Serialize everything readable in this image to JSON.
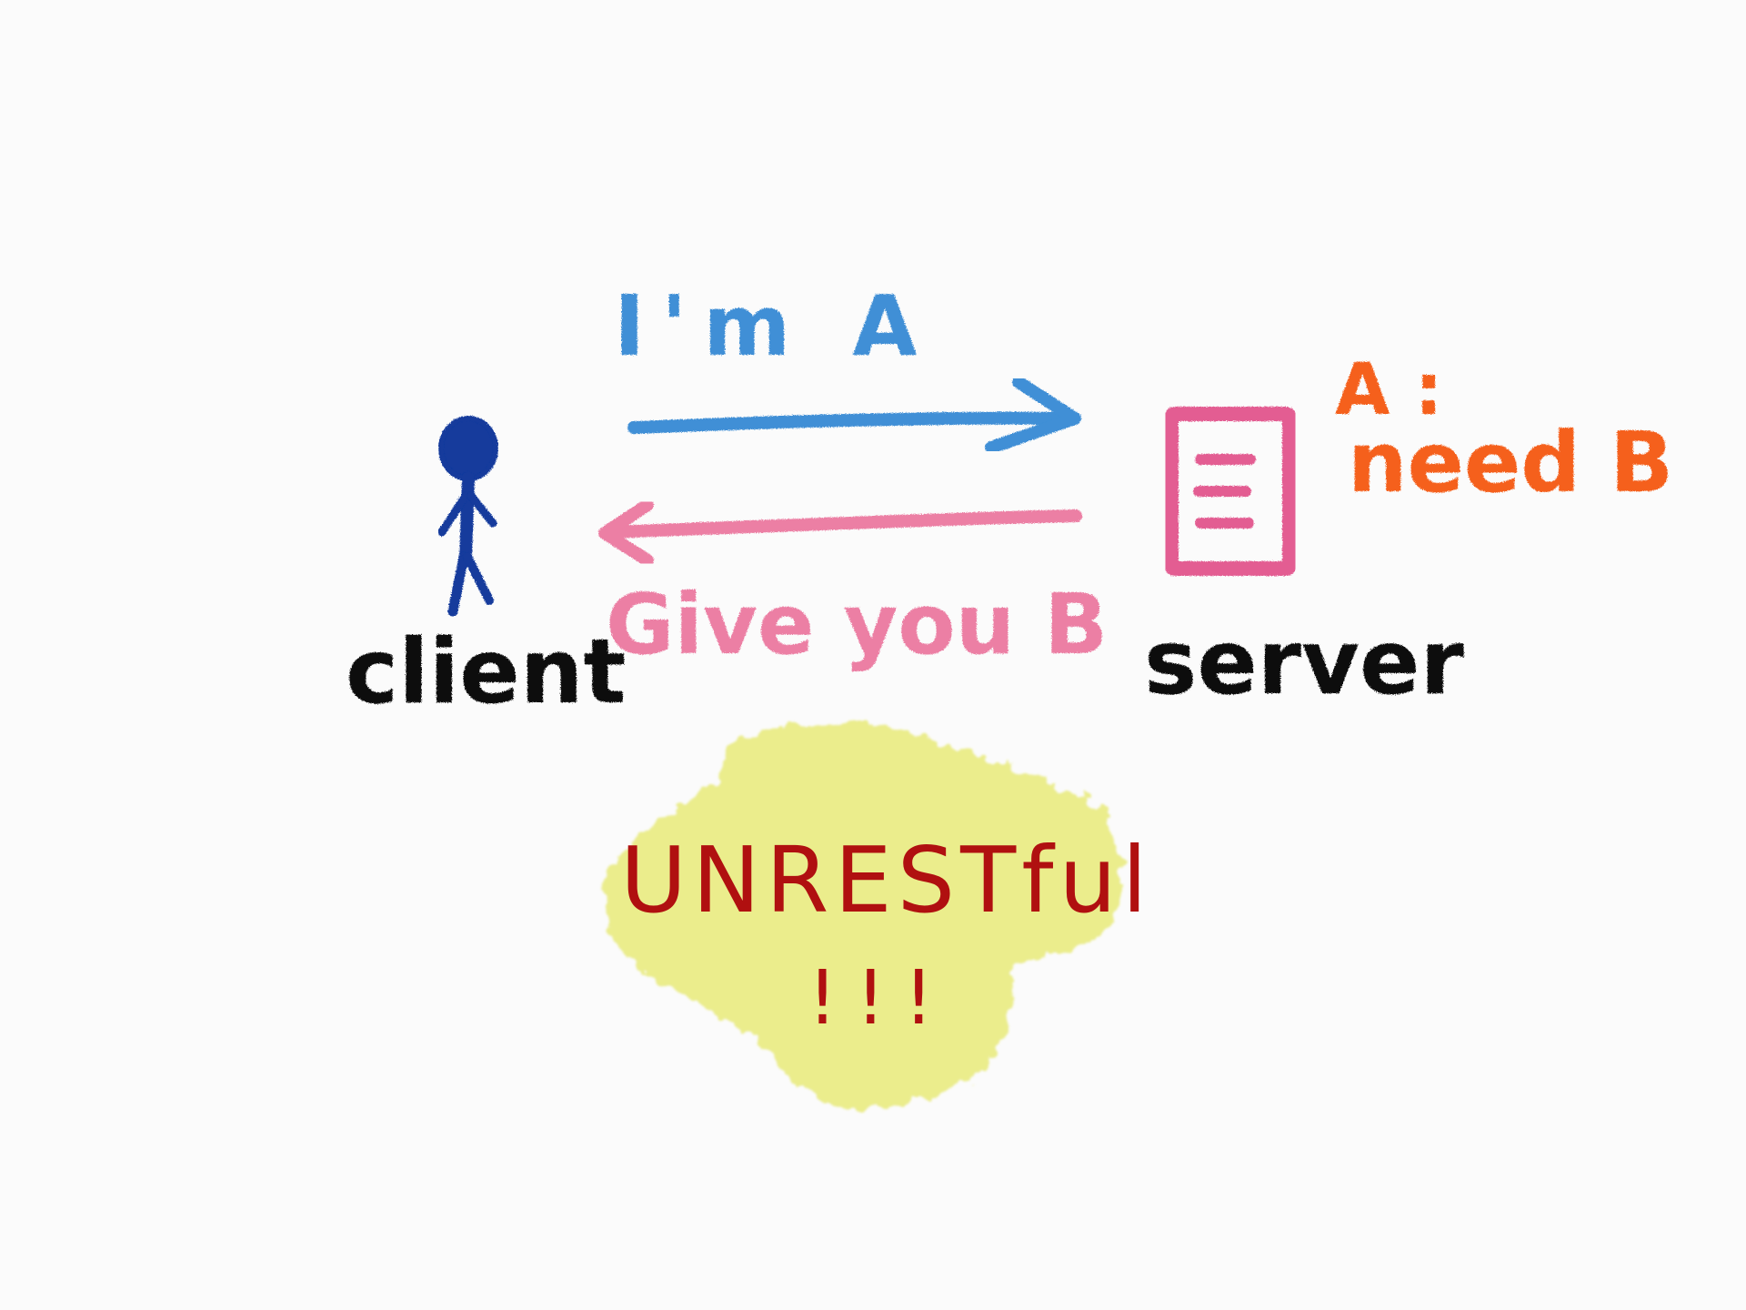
{
  "client": {
    "label": "client"
  },
  "server": {
    "label": "server",
    "note_line1": "A :",
    "note_line2": "need B"
  },
  "request": {
    "label": "I'm A"
  },
  "response": {
    "label": "Give you B"
  },
  "verdict": {
    "label": "UNRESTful",
    "exclaim": "!!!"
  },
  "colors": {
    "background": "#fbfbfb",
    "client_figure": "#123a9c",
    "request_arrow": "#3f8fd6",
    "response_arrow": "#ec7fa4",
    "server_box": "#e35d92",
    "server_note": "#f5611d",
    "ink": "#111111",
    "verdict_text": "#b01010",
    "verdict_blob": "#e9ec82"
  }
}
